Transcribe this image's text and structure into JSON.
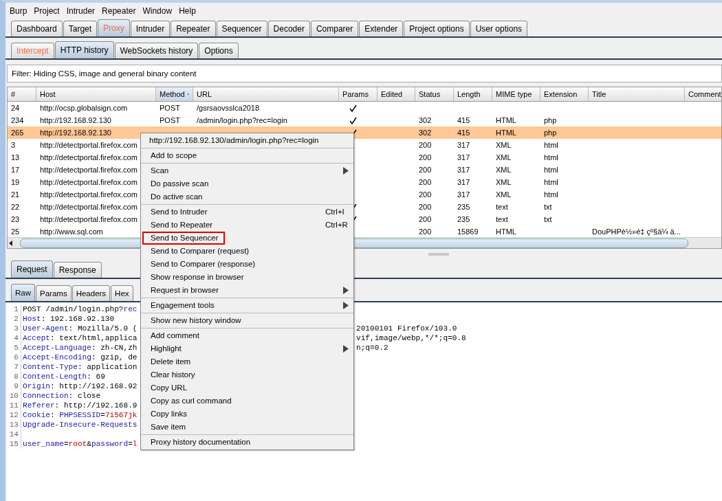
{
  "menu_bar": [
    "Burp",
    "Project",
    "Intruder",
    "Repeater",
    "Window",
    "Help"
  ],
  "main_tabs": [
    {
      "label": "Dashboard",
      "selected": false,
      "highlighted": false
    },
    {
      "label": "Target",
      "selected": false,
      "highlighted": false
    },
    {
      "label": "Proxy",
      "selected": true,
      "highlighted": true
    },
    {
      "label": "Intruder",
      "selected": false,
      "highlighted": false
    },
    {
      "label": "Repeater",
      "selected": false,
      "highlighted": false
    },
    {
      "label": "Sequencer",
      "selected": false,
      "highlighted": false
    },
    {
      "label": "Decoder",
      "selected": false,
      "highlighted": false
    },
    {
      "label": "Comparer",
      "selected": false,
      "highlighted": false
    },
    {
      "label": "Extender",
      "selected": false,
      "highlighted": false
    },
    {
      "label": "Project options",
      "selected": false,
      "highlighted": false
    },
    {
      "label": "User options",
      "selected": false,
      "highlighted": false
    }
  ],
  "proxy_tabs": [
    {
      "label": "Intercept",
      "selected": false,
      "highlighted": true
    },
    {
      "label": "HTTP history",
      "selected": true,
      "highlighted": false
    },
    {
      "label": "WebSockets history",
      "selected": false,
      "highlighted": false
    },
    {
      "label": "Options",
      "selected": false,
      "highlighted": false
    }
  ],
  "filter": "Filter: Hiding CSS, image and general binary content",
  "table": {
    "columns": [
      {
        "label": "#",
        "sorted": false
      },
      {
        "label": "Host",
        "sorted": false
      },
      {
        "label": "Method",
        "sorted": true
      },
      {
        "label": "URL",
        "sorted": false
      },
      {
        "label": "Params",
        "sorted": false
      },
      {
        "label": "Edited",
        "sorted": false
      },
      {
        "label": "Status",
        "sorted": false
      },
      {
        "label": "Length",
        "sorted": false
      },
      {
        "label": "MIME type",
        "sorted": false
      },
      {
        "label": "Extension",
        "sorted": false
      },
      {
        "label": "Title",
        "sorted": false
      },
      {
        "label": "Comment",
        "sorted": false
      }
    ],
    "rows": [
      {
        "num": "24",
        "host": "http://ocsp.globalsign.com",
        "method": "POST",
        "url": "/gsrsaovsslca2018",
        "params": true,
        "selected": false
      },
      {
        "num": "234",
        "host": "http://192.168.92.130",
        "method": "POST",
        "url": "/admin/login.php?rec=login",
        "params": true,
        "status": "302",
        "length": "415",
        "mime": "HTML",
        "ext": "php",
        "selected": false
      },
      {
        "num": "265",
        "host": "http://192.168.92.130",
        "params": true,
        "status": "302",
        "length": "415",
        "mime": "HTML",
        "ext": "php",
        "selected": true
      },
      {
        "num": "3",
        "host": "http://detectportal.firefox.com",
        "params": false,
        "status": "200",
        "length": "317",
        "mime": "XML",
        "ext": "html",
        "selected": false
      },
      {
        "num": "13",
        "host": "http://detectportal.firefox.com",
        "params": false,
        "status": "200",
        "length": "317",
        "mime": "XML",
        "ext": "html",
        "selected": false
      },
      {
        "num": "17",
        "host": "http://detectportal.firefox.com",
        "params": false,
        "status": "200",
        "length": "317",
        "mime": "XML",
        "ext": "html",
        "selected": false
      },
      {
        "num": "19",
        "host": "http://detectportal.firefox.com",
        "params": false,
        "status": "200",
        "length": "317",
        "mime": "XML",
        "ext": "html",
        "selected": false
      },
      {
        "num": "21",
        "host": "http://detectportal.firefox.com",
        "params": false,
        "status": "200",
        "length": "317",
        "mime": "XML",
        "ext": "html",
        "selected": false
      },
      {
        "num": "22",
        "host": "http://detectportal.firefox.com",
        "params": true,
        "status": "200",
        "length": "235",
        "mime": "text",
        "ext": "txt",
        "selected": false
      },
      {
        "num": "23",
        "host": "http://detectportal.firefox.com",
        "params": true,
        "status": "200",
        "length": "235",
        "mime": "text",
        "ext": "txt",
        "selected": false
      },
      {
        "num": "25",
        "host": "http://www.sql.com",
        "params": false,
        "status": "200",
        "length": "15869",
        "mime": "HTML",
        "title": "DouPHPè½»é‡ çº§ä¼ ä...",
        "selected": false
      }
    ]
  },
  "message_tabs": [
    {
      "label": "Request",
      "selected": true
    },
    {
      "label": "Response",
      "selected": false
    }
  ],
  "view_tabs": [
    {
      "label": "Raw",
      "selected": true
    },
    {
      "label": "Params",
      "selected": false
    },
    {
      "label": "Headers",
      "selected": false
    },
    {
      "label": "Hex",
      "selected": false
    }
  ],
  "request_lines": [
    {
      "num": "1",
      "parts": [
        {
          "kind": "plain",
          "text": "POST /admin/login.php?"
        },
        {
          "kind": "name",
          "text": "rec"
        }
      ]
    },
    {
      "num": "2",
      "parts": [
        {
          "kind": "name",
          "text": "Host"
        },
        {
          "kind": "plain",
          "text": ": 192.168.92.130"
        }
      ]
    },
    {
      "num": "3",
      "parts": [
        {
          "kind": "name",
          "text": "User-Agent"
        },
        {
          "kind": "plain",
          "text": ": Mozilla/5.0 ("
        }
      ],
      "tail": "20100101 Firefox/103.0"
    },
    {
      "num": "4",
      "parts": [
        {
          "kind": "name",
          "text": "Accept"
        },
        {
          "kind": "plain",
          "text": ": text/html,applica"
        }
      ],
      "tail": "vif,image/webp,*/*;q=0.8"
    },
    {
      "num": "5",
      "parts": [
        {
          "kind": "name",
          "text": "Accept-Language"
        },
        {
          "kind": "plain",
          "text": ": zh-CN,zh"
        }
      ],
      "tail": "n;q=0.2"
    },
    {
      "num": "6",
      "parts": [
        {
          "kind": "name",
          "text": "Accept-Encoding"
        },
        {
          "kind": "plain",
          "text": ": gzip, de"
        }
      ]
    },
    {
      "num": "7",
      "parts": [
        {
          "kind": "name",
          "text": "Content-Type"
        },
        {
          "kind": "plain",
          "text": ": application"
        }
      ]
    },
    {
      "num": "8",
      "parts": [
        {
          "kind": "name",
          "text": "Content-Length"
        },
        {
          "kind": "plain",
          "text": ": 69"
        }
      ]
    },
    {
      "num": "9",
      "parts": [
        {
          "kind": "name",
          "text": "Origin"
        },
        {
          "kind": "plain",
          "text": ": http://192.168.92"
        }
      ]
    },
    {
      "num": "10",
      "parts": [
        {
          "kind": "name",
          "text": "Connection"
        },
        {
          "kind": "plain",
          "text": ": close"
        }
      ]
    },
    {
      "num": "11",
      "parts": [
        {
          "kind": "name",
          "text": "Referer"
        },
        {
          "kind": "plain",
          "text": ": http://192.168.9"
        }
      ]
    },
    {
      "num": "12",
      "parts": [
        {
          "kind": "name",
          "text": "Cookie"
        },
        {
          "kind": "plain",
          "text": ": "
        },
        {
          "kind": "name",
          "text": "PHPSESSID"
        },
        {
          "kind": "plain",
          "text": "="
        },
        {
          "kind": "value",
          "text": "7i567jk"
        }
      ]
    },
    {
      "num": "13",
      "parts": [
        {
          "kind": "name",
          "text": "Upgrade-Insecure-Requests"
        }
      ]
    },
    {
      "num": "14"
    },
    {
      "num": "15",
      "parts": [
        {
          "kind": "name",
          "text": "user_name"
        },
        {
          "kind": "plain",
          "text": "="
        },
        {
          "kind": "value",
          "text": "root"
        },
        {
          "kind": "plain",
          "text": "&"
        },
        {
          "kind": "name",
          "text": "password"
        },
        {
          "kind": "plain",
          "text": "="
        },
        {
          "kind": "value",
          "text": "l"
        }
      ]
    }
  ],
  "context_menu": {
    "title": "http://192.168.92.130/admin/login.php?rec=login",
    "groups": [
      [
        {
          "label": "Add to scope",
          "submenu": false,
          "boxed": false
        }
      ],
      [
        {
          "label": "Scan",
          "submenu": true,
          "boxed": false
        },
        {
          "label": "Do passive scan",
          "submenu": false,
          "boxed": false
        },
        {
          "label": "Do active scan",
          "submenu": false,
          "boxed": false
        }
      ],
      [
        {
          "label": "Send to Intruder",
          "shortcut": "Ctrl+I",
          "submenu": false,
          "boxed": false
        },
        {
          "label": "Send to Repeater",
          "shortcut": "Ctrl+R",
          "submenu": false,
          "boxed": false
        },
        {
          "label": "Send to Sequencer",
          "submenu": false,
          "boxed": true
        },
        {
          "label": "Send to Comparer (request)",
          "submenu": false,
          "boxed": false
        },
        {
          "label": "Send to Comparer (response)",
          "submenu": false,
          "boxed": false
        },
        {
          "label": "Show response in browser",
          "submenu": false,
          "boxed": false
        },
        {
          "label": "Request in browser",
          "submenu": true,
          "boxed": false
        }
      ],
      [
        {
          "label": "Engagement tools",
          "submenu": true,
          "boxed": false
        }
      ],
      [
        {
          "label": "Show new history window",
          "submenu": false,
          "boxed": false
        }
      ],
      [
        {
          "label": "Add comment",
          "submenu": false,
          "boxed": false
        },
        {
          "label": "Highlight",
          "submenu": true,
          "boxed": false
        },
        {
          "label": "Delete item",
          "submenu": false,
          "boxed": false
        },
        {
          "label": "Clear history",
          "submenu": false,
          "boxed": false
        },
        {
          "label": "Copy URL",
          "submenu": false,
          "boxed": false
        },
        {
          "label": "Copy as curl command",
          "submenu": false,
          "boxed": false
        },
        {
          "label": "Copy links",
          "submenu": false,
          "boxed": false
        },
        {
          "label": "Save item",
          "submenu": false,
          "boxed": false
        }
      ],
      [
        {
          "label": "Proxy history documentation",
          "submenu": false,
          "boxed": false
        }
      ]
    ]
  }
}
